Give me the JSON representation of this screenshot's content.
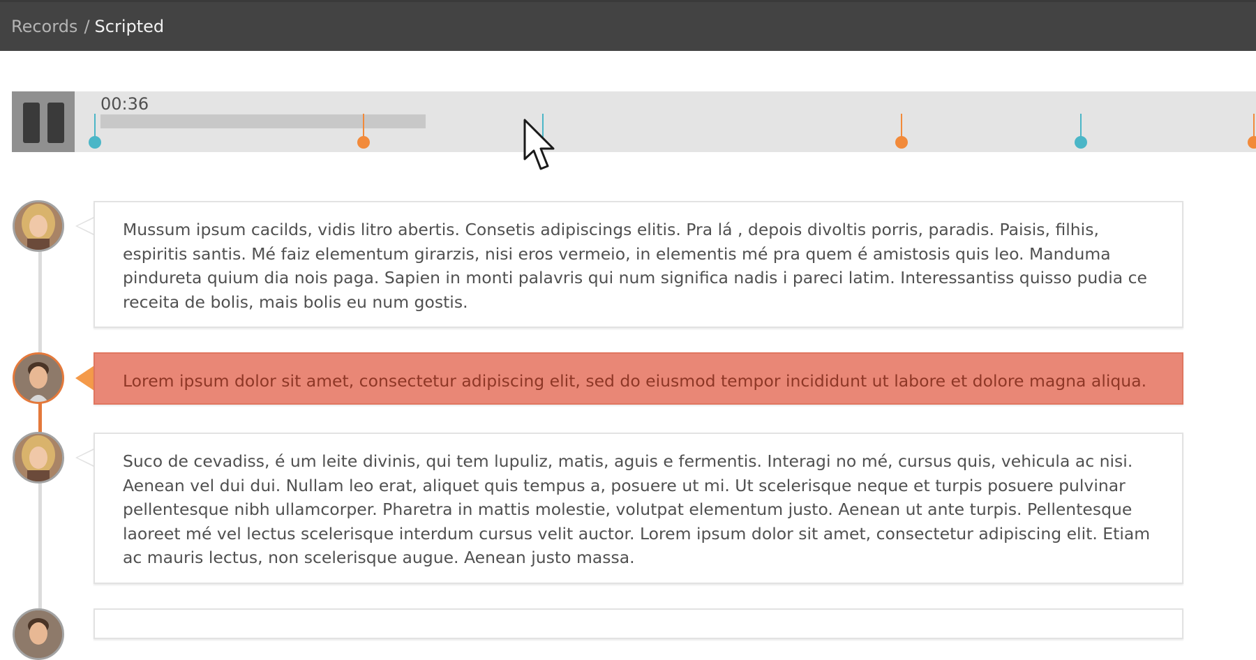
{
  "breadcrumb": {
    "root": "Records",
    "separator": "/",
    "current": "Scripted"
  },
  "player": {
    "time": "00:36",
    "state": "playing",
    "progress_fraction": 0.18,
    "pause_icon": "pause-icon",
    "marker_colors": {
      "agent": "#4bb6c7",
      "customer": "#f28a3a"
    }
  },
  "messages": [
    {
      "speaker": "agent",
      "text": "Mussum ipsum cacilds, vidis litro abertis. Consetis adipiscings elitis. Pra lá , depois divoltis porris, paradis. Paisis, filhis, espiritis santis. Mé faiz elementum girarzis, nisi eros vermeio, in elementis mé pra quem é amistosis quis leo. Manduma pindureta quium dia nois paga. Sapien in monti palavris qui num significa nadis i pareci latim. Interessantiss quisso pudia ce receita de bolis, mais bolis eu num gostis."
    },
    {
      "speaker": "customer",
      "highlighted": true,
      "text": "Lorem ipsum dolor sit amet, consectetur adipiscing elit, sed do eiusmod tempor incididunt ut labore et dolore magna aliqua."
    },
    {
      "speaker": "agent",
      "text": "Suco de cevadiss, é um leite divinis, qui tem lupuliz, matis, aguis e fermentis. Interagi no mé, cursus quis, vehicula ac nisi. Aenean vel dui dui. Nullam leo erat, aliquet quis tempus a, posuere ut mi. Ut scelerisque neque et turpis posuere pulvinar pellentesque nibh ullamcorper. Pharetra in mattis molestie, volutpat elementum justo. Aenean ut ante turpis. Pellentesque laoreet mé vel lectus scelerisque interdum cursus velit auctor. Lorem ipsum dolor sit amet, consectetur adipiscing elit. Etiam ac mauris lectus, non scelerisque augue. Aenean justo massa."
    }
  ],
  "colors": {
    "header_bg": "#434343",
    "highlight_bg": "#e98776",
    "accent_orange": "#e4793b",
    "accent_teal": "#4bb6c7"
  }
}
